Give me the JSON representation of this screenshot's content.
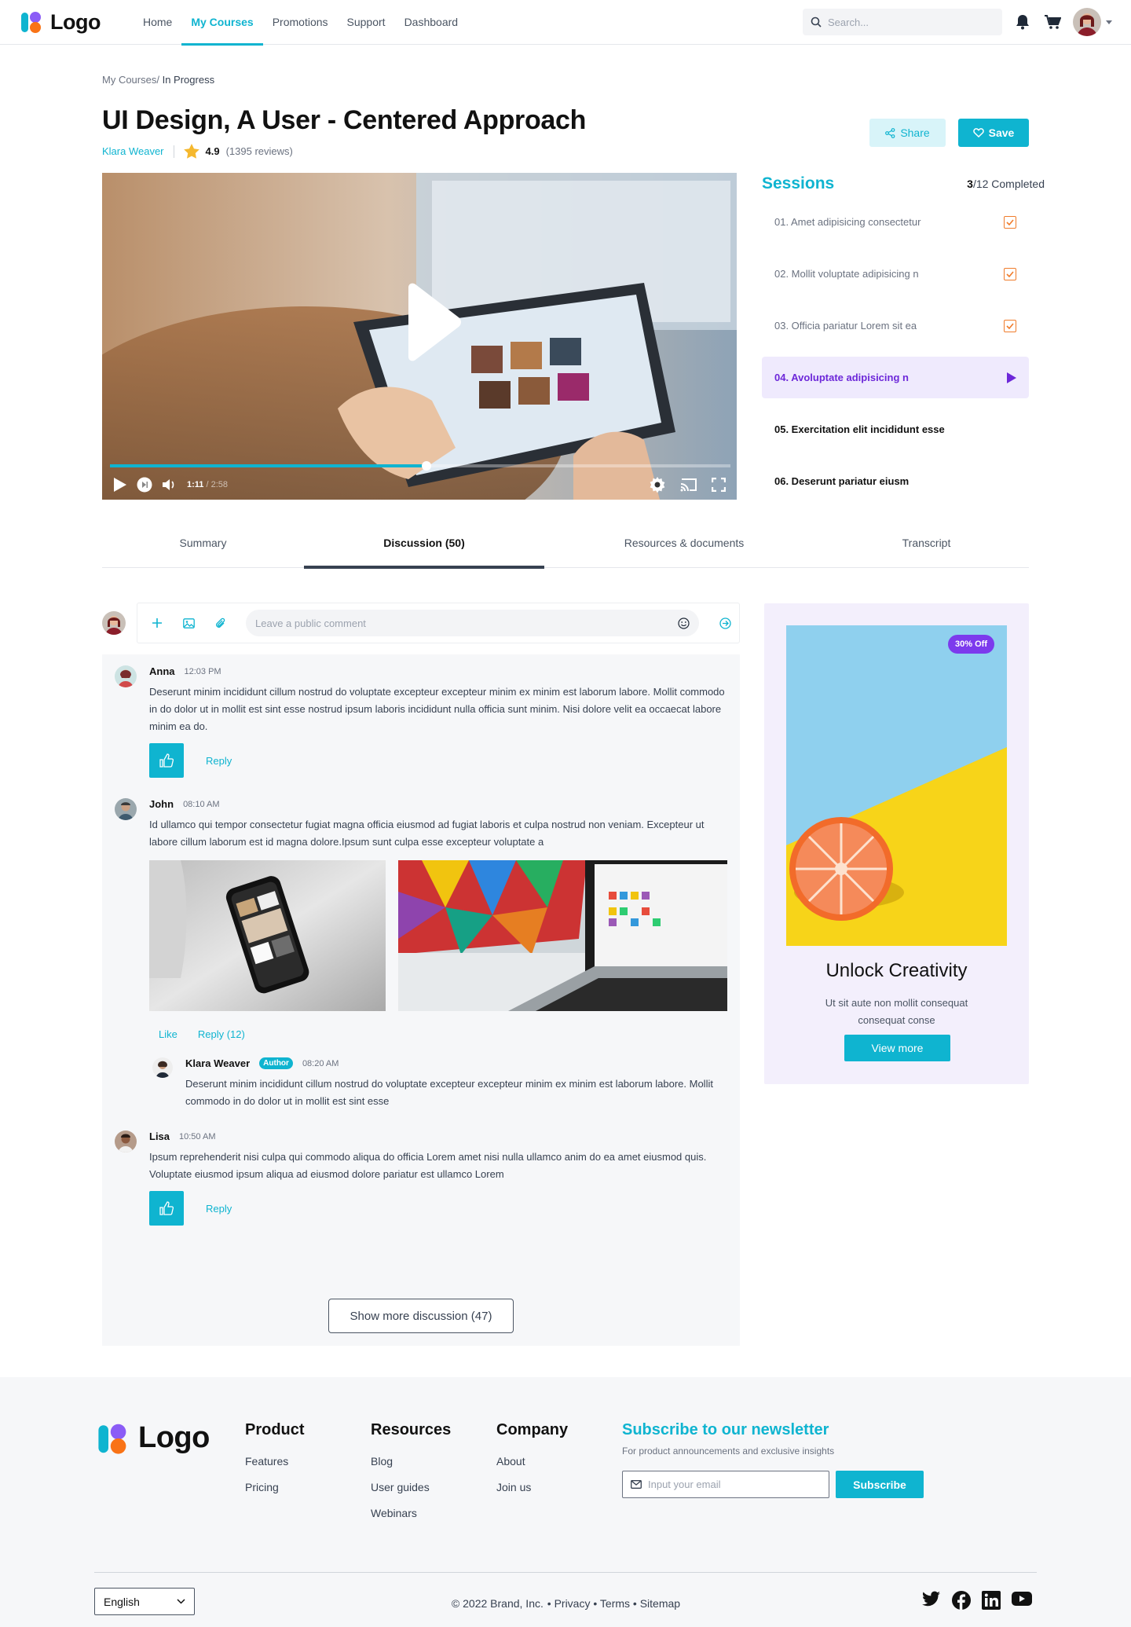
{
  "header": {
    "logo_text": "Logo",
    "nav": [
      {
        "label": "Home",
        "active": false
      },
      {
        "label": "My Courses",
        "active": true
      },
      {
        "label": "Promotions",
        "active": false
      },
      {
        "label": "Support",
        "active": false
      },
      {
        "label": "Dashboard",
        "active": false
      }
    ],
    "search_placeholder": "Search..."
  },
  "breadcrumb": {
    "parent": "My Courses/",
    "current": "In Progress"
  },
  "course": {
    "title": "UI Design, A User - Centered Approach",
    "author": "Klara Weaver",
    "rating": "4.9",
    "reviews": "(1395 reviews)",
    "share_label": "Share",
    "save_label": "Save"
  },
  "video": {
    "current_time": "1:11",
    "total_time": "/ 2:58",
    "progress": 0.51
  },
  "sessions": {
    "title": "Sessions",
    "completed_count": "3",
    "completed_text": "/12 Completed",
    "items": [
      {
        "label": "01. Amet adipisicing consectetur",
        "state": "done"
      },
      {
        "label": "02. Mollit voluptate adipisicing n",
        "state": "done"
      },
      {
        "label": "03. Officia pariatur Lorem sit ea",
        "state": "done"
      },
      {
        "label": "04. Avoluptate adipisicing n",
        "state": "active"
      },
      {
        "label": "05. Exercitation elit incididunt esse",
        "state": "todo"
      },
      {
        "label": "06. Deserunt pariatur eiusm",
        "state": "todo"
      }
    ]
  },
  "tabs": [
    "Summary",
    "Discussion (50)",
    "Resources & documents",
    "Transcript"
  ],
  "composer": {
    "placeholder": "Leave a public comment"
  },
  "comments": [
    {
      "name": "Anna",
      "time": "12:03 PM",
      "text": "Deserunt minim incididunt cillum nostrud do voluptate excepteur excepteur minim ex minim est laborum labore. Mollit commodo in do dolor ut in mollit est sint esse nostrud ipsum laboris incididunt nulla officia sunt minim. Nisi dolore velit ea occaecat labore minim ea do.",
      "reply_label": "Reply"
    },
    {
      "name": "John",
      "time": "08:10 AM",
      "text": "Id ullamco qui tempor consectetur fugiat magna officia eiusmod ad fugiat laboris et culpa nostrud non veniam. Excepteur ut labore cillum laborum est id magna dolore.Ipsum sunt culpa esse excepteur voluptate a",
      "like_label": "Like",
      "reply_label": "Reply (12)"
    },
    {
      "name": "Lisa",
      "time": "10:50 AM",
      "text": "Ipsum reprehenderit nisi culpa qui commodo aliqua do officia Lorem amet nisi nulla ullamco anim do ea amet eiusmod quis. Voluptate eiusmod ipsum aliqua ad eiusmod dolore pariatur est ullamco Lorem",
      "reply_label": "Reply"
    }
  ],
  "reply": {
    "name": "Klara Weaver",
    "badge": "Author",
    "time": "08:20 AM",
    "text": "Deserunt minim incididunt cillum nostrud do voluptate excepteur excepteur minim ex minim est laborum labore. Mollit commodo in do dolor ut in mollit est sint esse"
  },
  "show_more_label": "Show more discussion (47)",
  "ad": {
    "badge": "30% Off",
    "title": "Unlock Creativity",
    "text": "Ut sit aute non mollit consequat consequat conse",
    "button": "View more"
  },
  "footer": {
    "logo_text": "Logo",
    "columns": [
      {
        "title": "Product",
        "links": [
          "Features",
          "Pricing"
        ]
      },
      {
        "title": "Resources",
        "links": [
          "Blog",
          "User guides",
          "Webinars"
        ]
      },
      {
        "title": "Company",
        "links": [
          "About",
          "Join us"
        ]
      }
    ],
    "newsletter": {
      "title": "Subscribe to our newsletter",
      "subtitle": "For product announcements and exclusive insights",
      "placeholder": "Input your email",
      "button": "Subscribe"
    },
    "language": "English",
    "copyright": "© 2022 Brand, Inc.",
    "links": [
      "Privacy",
      "Terms",
      "Sitemap"
    ],
    "social_icons": [
      "twitter-icon",
      "facebook-icon",
      "linkedin-icon",
      "youtube-icon"
    ]
  },
  "colors": {
    "accent": "#0fb4d0",
    "active_session": "#6d28d9",
    "check": "#f07c2b",
    "ad_badge": "#7c3aed"
  }
}
